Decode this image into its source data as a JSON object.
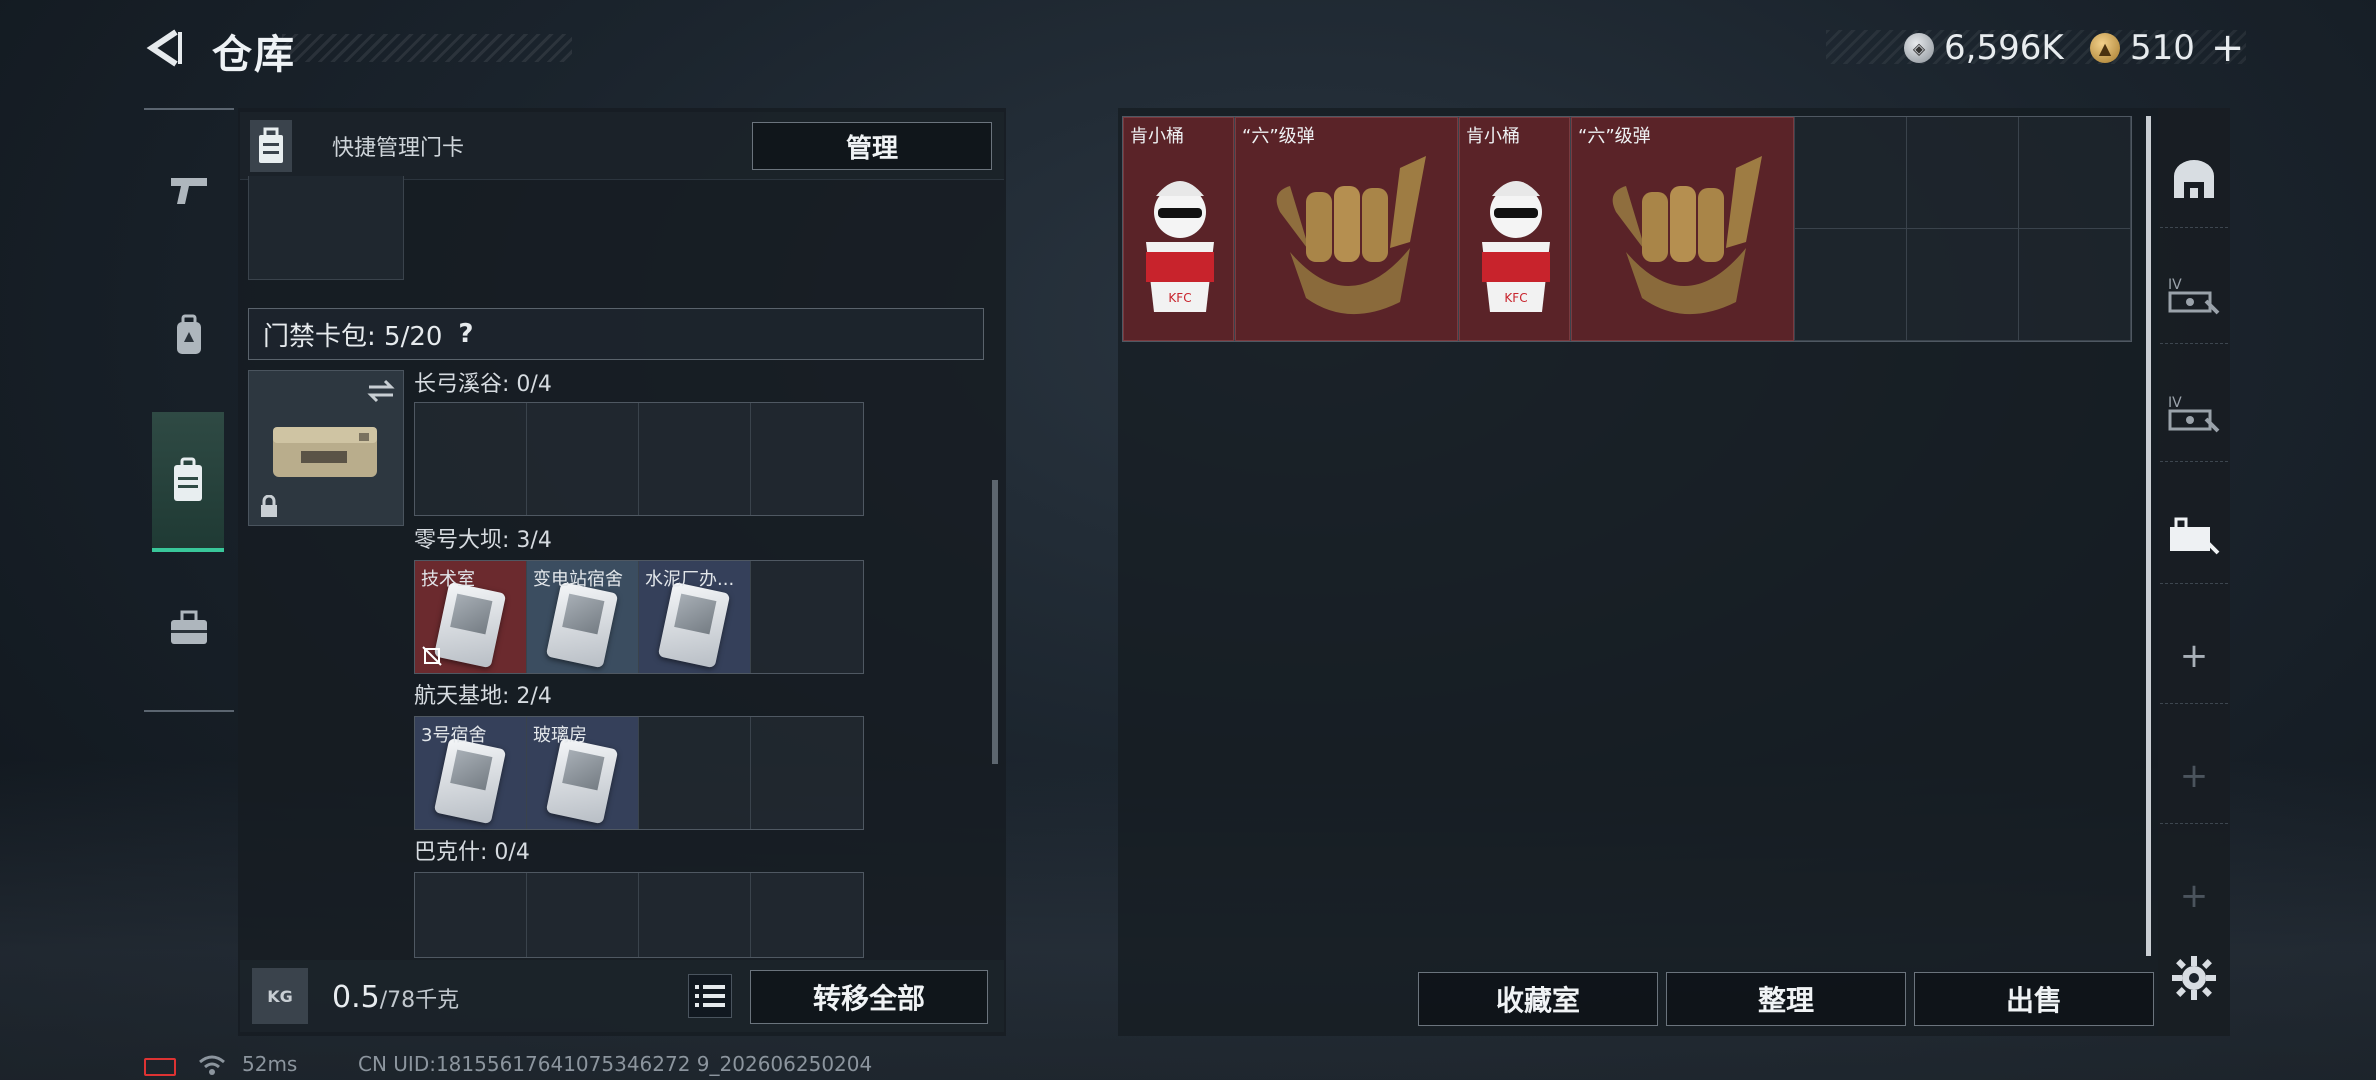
{
  "header": {
    "title": "仓库",
    "currency": [
      {
        "icon": "silver-coin-icon",
        "value": "6,596K"
      },
      {
        "icon": "gold-coin-icon",
        "value": "510"
      }
    ]
  },
  "tabs": [
    {
      "name": "weapons-tab-icon"
    },
    {
      "name": "backpack-tab-icon"
    },
    {
      "name": "keycard-tab-icon",
      "active": true
    },
    {
      "name": "toolbox-tab-icon"
    }
  ],
  "left": {
    "quick_label": "快捷管理门卡",
    "manage_label": "管理",
    "wallet_label": "门禁卡包: 5/20",
    "wallet_help": "?",
    "sections": [
      {
        "title": "长弓溪谷: 0/4",
        "cells": [
          null,
          null,
          null,
          null
        ]
      },
      {
        "title": "零号大坝: 3/4",
        "cells": [
          {
            "name": "技术室",
            "color": "red"
          },
          {
            "name": "变电站宿舍",
            "color": "blue"
          },
          {
            "name": "水泥厂办...",
            "color": "dblue"
          },
          null
        ]
      },
      {
        "title": "航天基地: 2/4",
        "cells": [
          {
            "name": "3号宿舍",
            "color": "dblue"
          },
          {
            "name": "玻璃房",
            "color": "dblue"
          },
          null,
          null
        ]
      },
      {
        "title": "巴克什: 0/4",
        "cells": [
          null,
          null,
          null,
          null
        ]
      }
    ],
    "weight_value": "0.5",
    "weight_max": "/78千克",
    "kg_icon": "KG",
    "transfer_label": "转移全部"
  },
  "right": {
    "items": [
      {
        "name": "肯小桶",
        "kind": "figure",
        "col": 0,
        "w": 1
      },
      {
        "name": "“六”级弹",
        "kind": "hand",
        "col": 1,
        "w": 2
      },
      {
        "name": "肯小桶",
        "kind": "figure",
        "col": 3,
        "w": 1
      },
      {
        "name": "“六”级弹",
        "kind": "hand",
        "col": 4,
        "w": 2
      }
    ],
    "buttons": {
      "collection": "收藏室",
      "sort": "整理",
      "sell": "出售"
    }
  },
  "status": {
    "ping": "52ms",
    "uid": "CN UID:18155617641075346272 9_202606250204"
  }
}
